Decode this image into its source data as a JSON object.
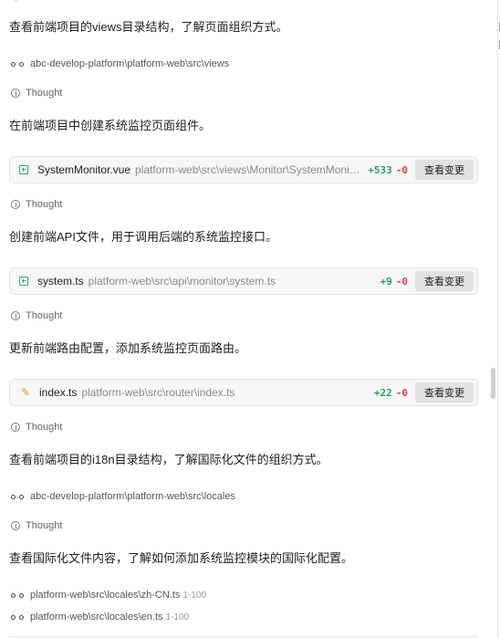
{
  "messages": [
    "查看前端项目的views目录结构，了解页面组织方式。",
    "在前端项目中创建系统监控页面组件。",
    "创建前端API文件，用于调用后端的系统监控接口。",
    "更新前端路由配置，添加系统监控页面路由。",
    "查看前端项目的i18n目录结构，了解国际化文件的组织方式。",
    "查看国际化文件内容，了解如何添加系统监控模块的国际化配置。"
  ],
  "thought_label": "Thought",
  "refs": {
    "views_dir": "abc-develop-platform\\platform-web\\src\\views",
    "locales_dir": "abc-develop-platform\\platform-web\\src\\locales",
    "zh_cn_file": "platform-web\\src\\locales\\zh-CN.ts",
    "zh_cn_range": "1-100",
    "en_file": "platform-web\\src\\locales\\en.ts",
    "en_range": "1-100"
  },
  "cards": [
    {
      "name": "SystemMonitor.vue",
      "path": "platform-web\\src\\views\\Monitor\\SystemMonitor.vue",
      "added": "+533",
      "deleted": "-0",
      "button": "查看变更"
    },
    {
      "name": "system.ts",
      "path": "platform-web\\src\\api\\monitor\\system.ts",
      "added": "+9",
      "deleted": "-0",
      "button": "查看变更"
    },
    {
      "name": "index.ts",
      "path": "platform-web\\src\\router\\index.ts",
      "added": "+22",
      "deleted": "-0",
      "button": "查看变更"
    }
  ],
  "colors": {
    "added": "#2e9d5c",
    "deleted": "#d64545",
    "new_file_icon": "#3aa56b",
    "edit_icon": "#d9a21f"
  },
  "icons": {
    "thought": "info-circle-icon",
    "ref": "glasses-icon",
    "new_file": "file-plus-icon",
    "edit": "pencil-icon"
  }
}
